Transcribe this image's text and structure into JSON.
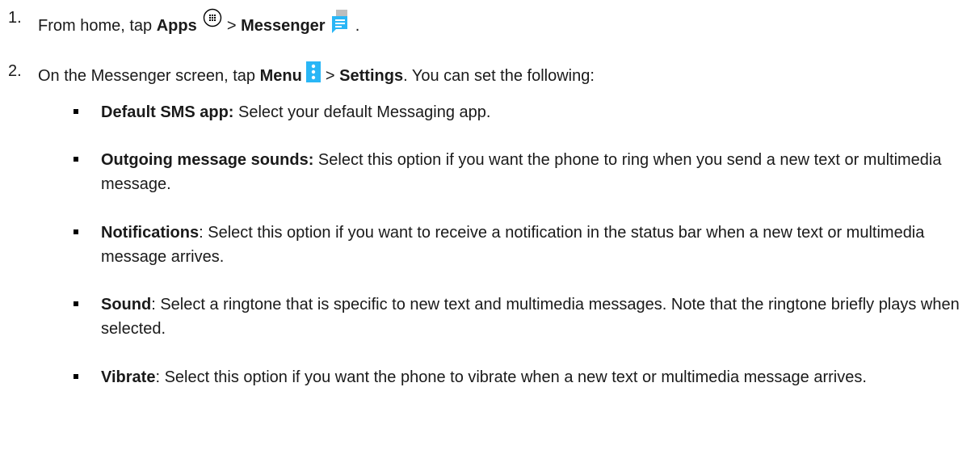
{
  "steps": [
    {
      "number": "1.",
      "t1": "From home, tap ",
      "b1": "Apps",
      "t2": " > ",
      "b2": "Messenger",
      "t3": " .",
      "icon1": "apps-icon",
      "icon2": "messenger-icon"
    },
    {
      "number": "2.",
      "t1": "On the Messenger screen, tap ",
      "b1": "Menu",
      "t2": " > ",
      "b2": "Settings",
      "t3": ". You can set the following:",
      "icon1": "menu-icon"
    }
  ],
  "bullets": [
    {
      "title": "Default SMS app:",
      "text": " Select your default Messaging app."
    },
    {
      "title": "Outgoing message sounds:",
      "text": " Select this option if you want the phone to ring when you send a new text or multimedia message."
    },
    {
      "title": "Notifications",
      "text": ": Select this option if you want to receive a notification in the status bar when a new text or multimedia message arrives."
    },
    {
      "title": "Sound",
      "text": ": Select a ringtone that is specific to new text and multimedia messages. Note that the ringtone briefly plays when selected."
    },
    {
      "title": "Vibrate",
      "text": ": Select this option if you want the phone to vibrate when a new text or multimedia message arrives."
    }
  ],
  "colors": {
    "messenger_blue": "#29B6F6",
    "menu_blue": "#29B6F6",
    "text": "#1a1a1a"
  }
}
